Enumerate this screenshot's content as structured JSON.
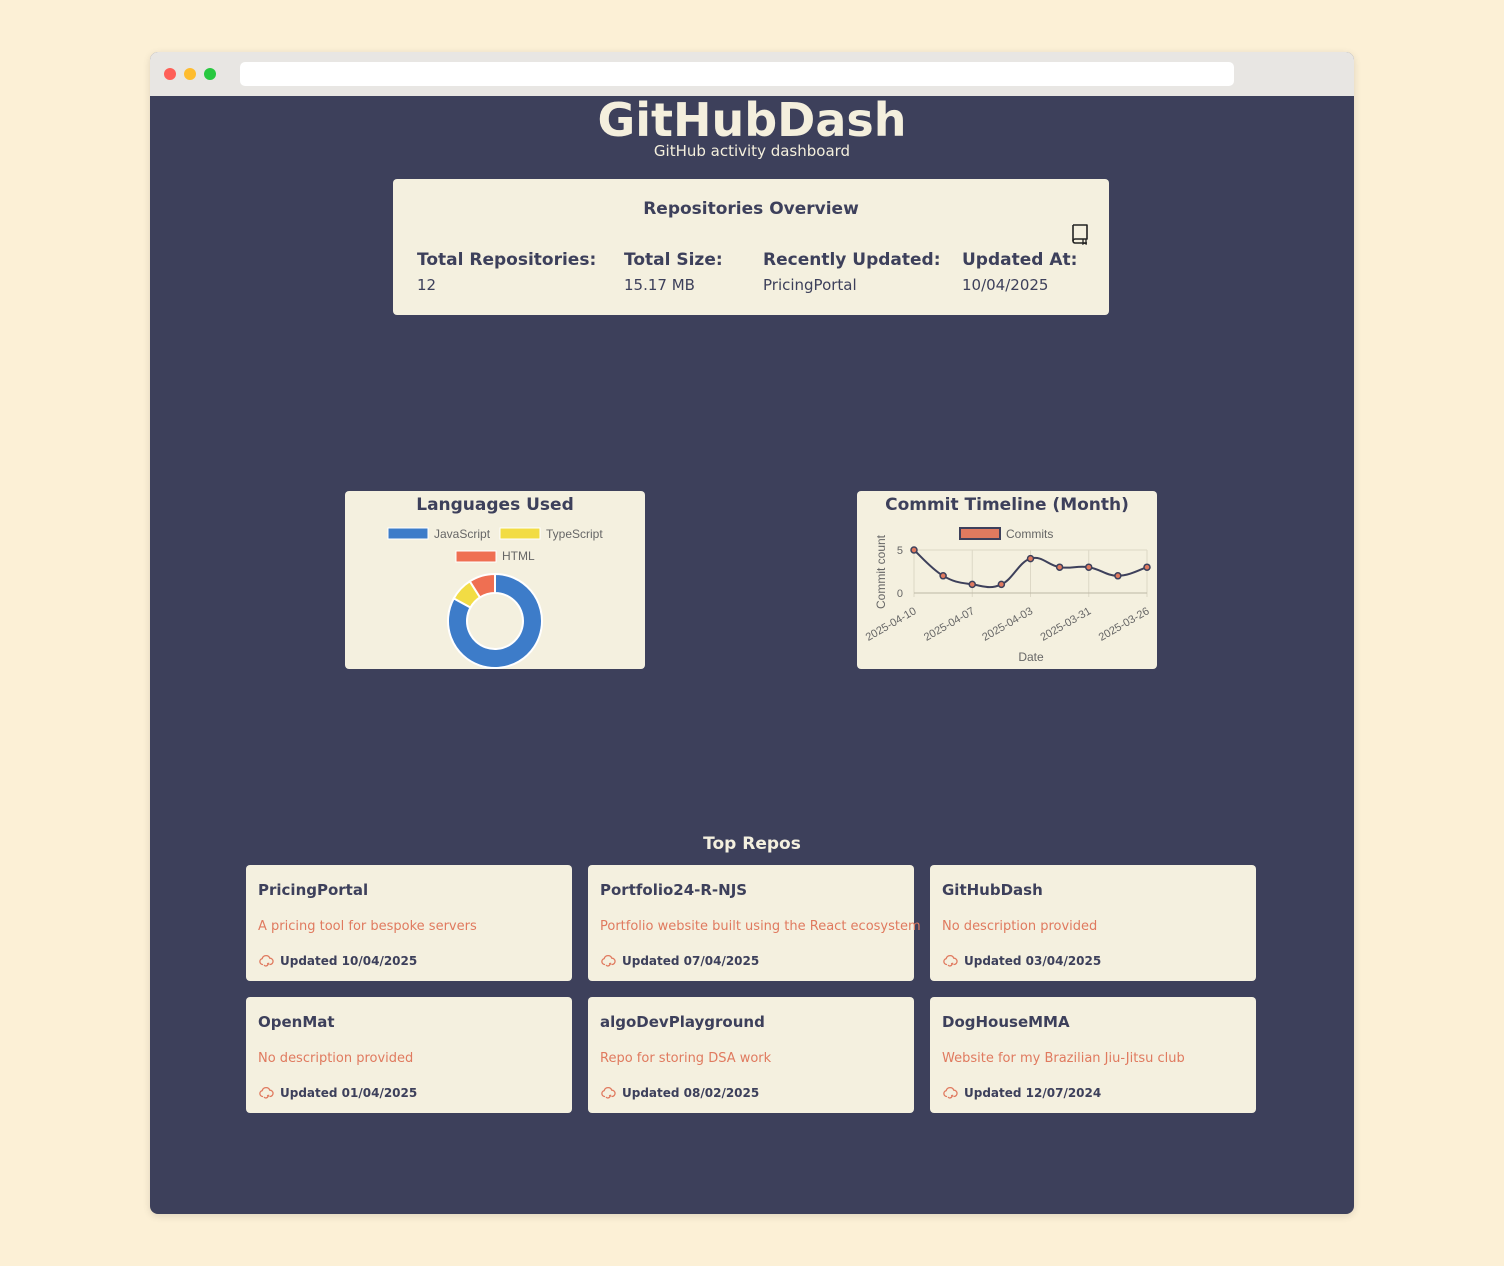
{
  "app": {
    "title": "GitHubDash",
    "subtitle": "GitHub activity dashboard"
  },
  "overview": {
    "title": "Repositories Overview",
    "icon": "book-icon",
    "stats": [
      {
        "label": "Total Repositories:",
        "value": "12"
      },
      {
        "label": "Total Size:",
        "value": "15.17 MB"
      },
      {
        "label": "Recently Updated:",
        "value": "PricingPortal"
      },
      {
        "label": "Updated At:",
        "value": "10/04/2025"
      }
    ]
  },
  "languages": {
    "title": "Languages Used",
    "legend": [
      "JavaScript",
      "TypeScript",
      "HTML"
    ]
  },
  "commits": {
    "title": "Commit Timeline (Month)",
    "legend": "Commits",
    "xlabel": "Date",
    "ylabel": "Commit count",
    "y_ticks": [
      "0",
      "5"
    ],
    "x_tick_labels": [
      "2025-04-10",
      "2025-04-07",
      "2025-04-03",
      "2025-03-31",
      "2025-03-26"
    ]
  },
  "chart_data": [
    {
      "type": "pie",
      "title": "Languages Used",
      "categories": [
        "JavaScript",
        "TypeScript",
        "HTML"
      ],
      "values": [
        83,
        8,
        9
      ],
      "colors": [
        "#3d7cc9",
        "#f2dc44",
        "#ef6f52"
      ],
      "legend_position": "top",
      "donut": true
    },
    {
      "type": "line",
      "title": "Commit Timeline (Month)",
      "x": [
        "2025-04-10",
        "2025-04-09",
        "2025-04-07",
        "2025-04-05",
        "2025-04-03",
        "2025-04-01",
        "2025-03-31",
        "2025-03-28",
        "2025-03-26"
      ],
      "series": [
        {
          "name": "Commits",
          "values": [
            5,
            2,
            1,
            1,
            4,
            3,
            3,
            2,
            3
          ]
        }
      ],
      "xlabel": "Date",
      "ylabel": "Commit count",
      "ylim": [
        0,
        5
      ],
      "grid": true,
      "legend_position": "top",
      "colors": {
        "line": "#3d405b",
        "point": "#e07a5f"
      }
    }
  ],
  "top_repos": {
    "title": "Top Repos",
    "icon": "cloud-refresh-icon",
    "items": [
      {
        "name": "PricingPortal",
        "description": "A pricing tool for bespoke servers",
        "updated": "Updated 10/04/2025"
      },
      {
        "name": "Portfolio24-R-NJS",
        "description": "Portfolio website built using the React ecosystem",
        "updated": "Updated 07/04/2025"
      },
      {
        "name": "GitHubDash",
        "description": "No description provided",
        "updated": "Updated 03/04/2025"
      },
      {
        "name": "OpenMat",
        "description": "No description provided",
        "updated": "Updated 01/04/2025"
      },
      {
        "name": "algoDevPlayground",
        "description": "Repo for storing DSA work",
        "updated": "Updated 08/02/2025"
      },
      {
        "name": "DogHouseMMA",
        "description": "Website for my Brazilian Jiu-Jitsu club",
        "updated": "Updated 12/07/2024"
      }
    ]
  },
  "colors": {
    "background": "#fcf0d6",
    "panel": "#3d405b",
    "card": "#f4f0df",
    "accent": "#e07a5f"
  }
}
